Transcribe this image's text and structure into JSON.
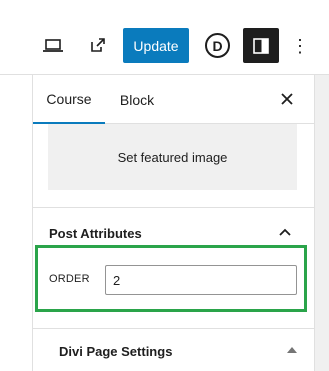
{
  "toolbar": {
    "update_label": "Update",
    "divi_label": "D",
    "more_label": "⋮",
    "colors": {
      "primary": "#0a7bbd",
      "dark": "#1e1e1e"
    }
  },
  "sidebar": {
    "tabs": [
      {
        "label": "Course",
        "active": true
      },
      {
        "label": "Block",
        "active": false
      }
    ],
    "close_label": "×",
    "featured_image_label": "Set featured image",
    "post_attributes": {
      "title": "Post Attributes",
      "order_label": "ORDER",
      "order_value": "2"
    },
    "divi_settings": {
      "title": "Divi Page Settings"
    },
    "highlight_color": "#2aa44a"
  }
}
